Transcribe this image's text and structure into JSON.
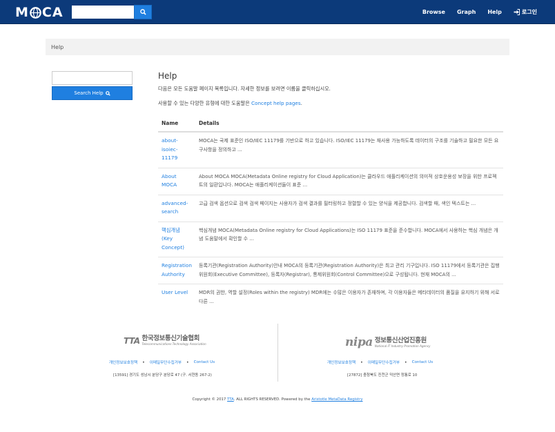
{
  "header": {
    "logo_text_left": "M",
    "logo_text_right": "CA",
    "search_placeholder": "",
    "nav": [
      {
        "label": "Browse"
      },
      {
        "label": "Graph"
      },
      {
        "label": "Help"
      },
      {
        "label": "로그인"
      }
    ]
  },
  "breadcrumb": {
    "current": "Help"
  },
  "sidebar": {
    "search_placeholder": "",
    "search_button_label": "Search Help"
  },
  "main": {
    "title": "Help",
    "intro": "다음은 모든 도움말 페이지 목록입니다. 자세한 정보를 보려면 이름을 클릭하십시오.",
    "intro2_prefix": "사용할 수 있는 다양한 유형에 대한 도움말은 ",
    "intro2_link": "Concept help pages",
    "intro2_suffix": ".",
    "table": {
      "columns": [
        "Name",
        "Details"
      ],
      "rows": [
        {
          "name": "about-isoiec-11179",
          "details": "MOCA는 국제 표준인 ISO/IEC 11179를 기반으로 하고 있습니다. ISO/IEC 11179는 재사용 가능하도록 데이터의 구조를 기술하고 필요한 모든 요구사항을 정의하고 ..."
        },
        {
          "name": "About MOCA",
          "details": "About MOCA MOCA(Metadata Online registry for Cloud Application)는 클라우드 애플리케이션의 의미적 상호운용성 보장을 위한 프로젝트의 일환입니다. MOCA는 애플리케이션들이 표준 ..."
        },
        {
          "name": "advanced-search",
          "details": "고급 검색 옵션으로 검색 검색 페이지는 사용자가 검색 결과를 필터링하고 정렬할 수 있는 양식을 제공합니다. 검색할 때, 색인 텍스트는 ..."
        },
        {
          "name": "핵심개념 (Key Concept)",
          "details": "핵심개념 MOCA(Metadata Online registry for Cloud Applications)는 ISO 11179 표준을 준수합니다. MOCA에서 사용하는 핵심 개념은 개념 도움말에서 확인할 수 ..."
        },
        {
          "name": "Registration Authority",
          "details": "등록기관(Registration Authority)안내 MOCA의 등록기관(Registration Authority)은 최고 관리 기구입니다. ISO 11179에서 등록기관은 집행위원회(Executive Committee), 등록자(Registrar), 통제위원회(Control Committee)으로 구성됩니다. 현재 MOCA의 ..."
        },
        {
          "name": "User Level",
          "details": "MDR의 권한, 역할 설정(Roles within the registry) MDR에는 수많은 이용자가 존재하며, 각 이용자들은 메타데이터의 품질을 유지하기 위해 서로 다른 ..."
        }
      ]
    }
  },
  "footer": {
    "tta": {
      "mark": "TTA",
      "name": "한국정보통신기술협회",
      "sub": "Telecommunications Technology Association",
      "links": [
        "개인정보보호정책",
        "이메일무단수집거부",
        "Contact Us"
      ],
      "address": "[13591] 경기도 성남시 분당구 분당로 47 (구. 서현동 267-2)"
    },
    "nipa": {
      "mark": "nipa",
      "name": "정보통신산업진흥원",
      "sub": "National IT Industry Promotion Agency",
      "links": [
        "개인정보보호정책",
        "이메일무단수집거부",
        "Contact Us"
      ],
      "address": "[27872] 충청북도 진천군 덕산면 정통로 10"
    },
    "copyright_prefix": "Copyright © 2017 ",
    "copyright_tta": "TTA",
    "copyright_mid": ". ALL RIGHTS RESERVED. Powered by the ",
    "copyright_link": "Aristotle MetaData Registry"
  },
  "colors": {
    "navbar": "#0c3a7a",
    "accent": "#1f7fe0",
    "breadcrumb_bg": "#f2f2f2"
  },
  "icons": {
    "search": "search-icon",
    "login": "sign-in-icon"
  }
}
